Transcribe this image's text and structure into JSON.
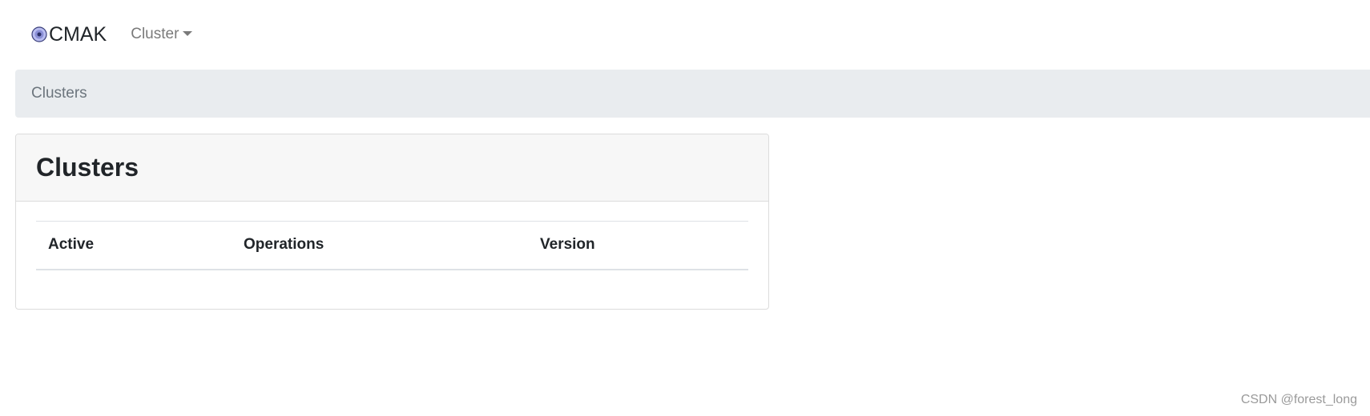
{
  "navbar": {
    "brand": "CMAK",
    "brand_icon": "target-logo-icon",
    "dropdown_label": "Cluster",
    "dropdown_icon": "caret-down-icon"
  },
  "breadcrumb": {
    "items": [
      "Clusters"
    ]
  },
  "card": {
    "title": "Clusters",
    "table": {
      "columns": [
        "Active",
        "Operations",
        "Version"
      ],
      "rows": []
    }
  },
  "watermark": "CSDN @forest_long",
  "colors": {
    "breadcrumb_bg": "#e9ecef",
    "card_header_bg": "#f7f7f7",
    "muted_text": "#6c757d",
    "logo_fill": "#8a8fd6"
  }
}
